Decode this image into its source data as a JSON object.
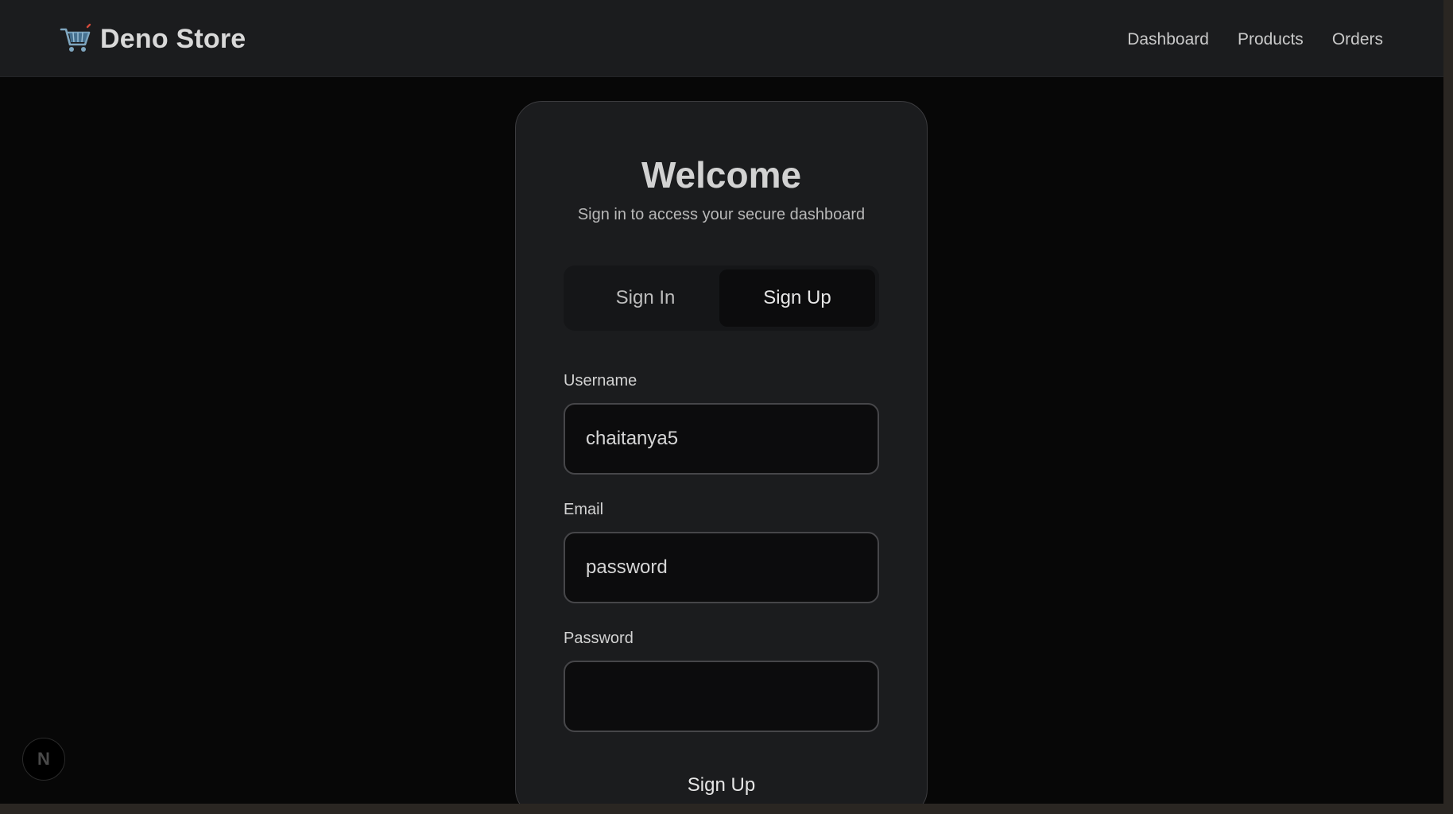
{
  "header": {
    "brand": "Deno Store",
    "brand_icon": "shopping-cart-icon",
    "nav": [
      "Dashboard",
      "Products",
      "Orders"
    ]
  },
  "card": {
    "title": "Welcome",
    "subtitle": "Sign in to access your secure dashboard",
    "tabs": [
      {
        "label": "Sign In",
        "active": false
      },
      {
        "label": "Sign Up",
        "active": true
      }
    ],
    "fields": {
      "username": {
        "label": "Username",
        "value": "chaitanya5"
      },
      "email": {
        "label": "Email",
        "value": "password"
      },
      "password": {
        "label": "Password",
        "value": ""
      }
    },
    "submit_label": "Sign Up"
  },
  "dev_badge": {
    "letter": "N",
    "icon": "nextjs-logo-icon"
  },
  "colors": {
    "page_bg": "#070707",
    "header_bg": "#1b1c1e",
    "card_bg": "#1b1c1e",
    "input_bg": "#0c0c0d",
    "text": "#d2d2d2"
  }
}
